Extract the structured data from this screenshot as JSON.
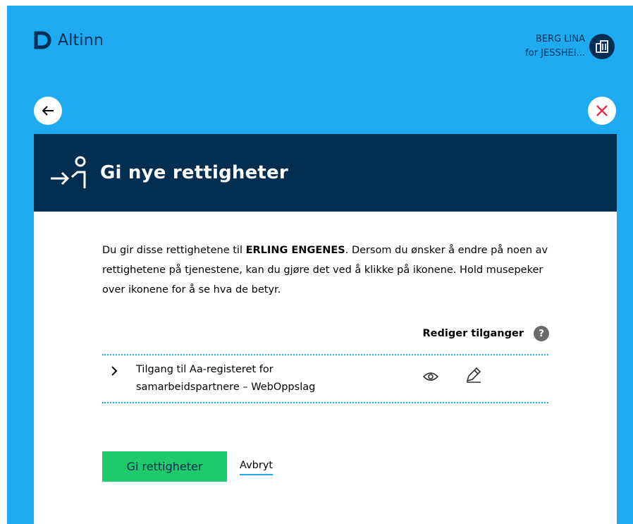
{
  "app": {
    "name": "Altinn"
  },
  "user": {
    "name": "BERG LINA",
    "on_behalf": "for JESSHEI..."
  },
  "page": {
    "title": "Gi nye rettigheter"
  },
  "intro": {
    "prefix": "Du gir disse rettighetene til ",
    "recipient": "ERLING ENGENES",
    "suffix": ". Dersom du ønsker å endre på noen av rettighetene på tjenestene, kan du gjøre det ved å klikke på ikonene. Hold musepeker over ikonene for å se hva de betyr."
  },
  "rights": {
    "edit_header": "Rediger tilganger",
    "help_symbol": "?",
    "items": [
      {
        "label": "Tilgang til Aa-registeret for samarbeidspartnere – WebOppslag"
      }
    ]
  },
  "actions": {
    "primary": "Gi rettigheter",
    "cancel": "Avbryt"
  },
  "colors": {
    "background": "#1eaaf1",
    "header": "#022f51",
    "primary": "#1eca6a",
    "close": "#e02e49"
  }
}
